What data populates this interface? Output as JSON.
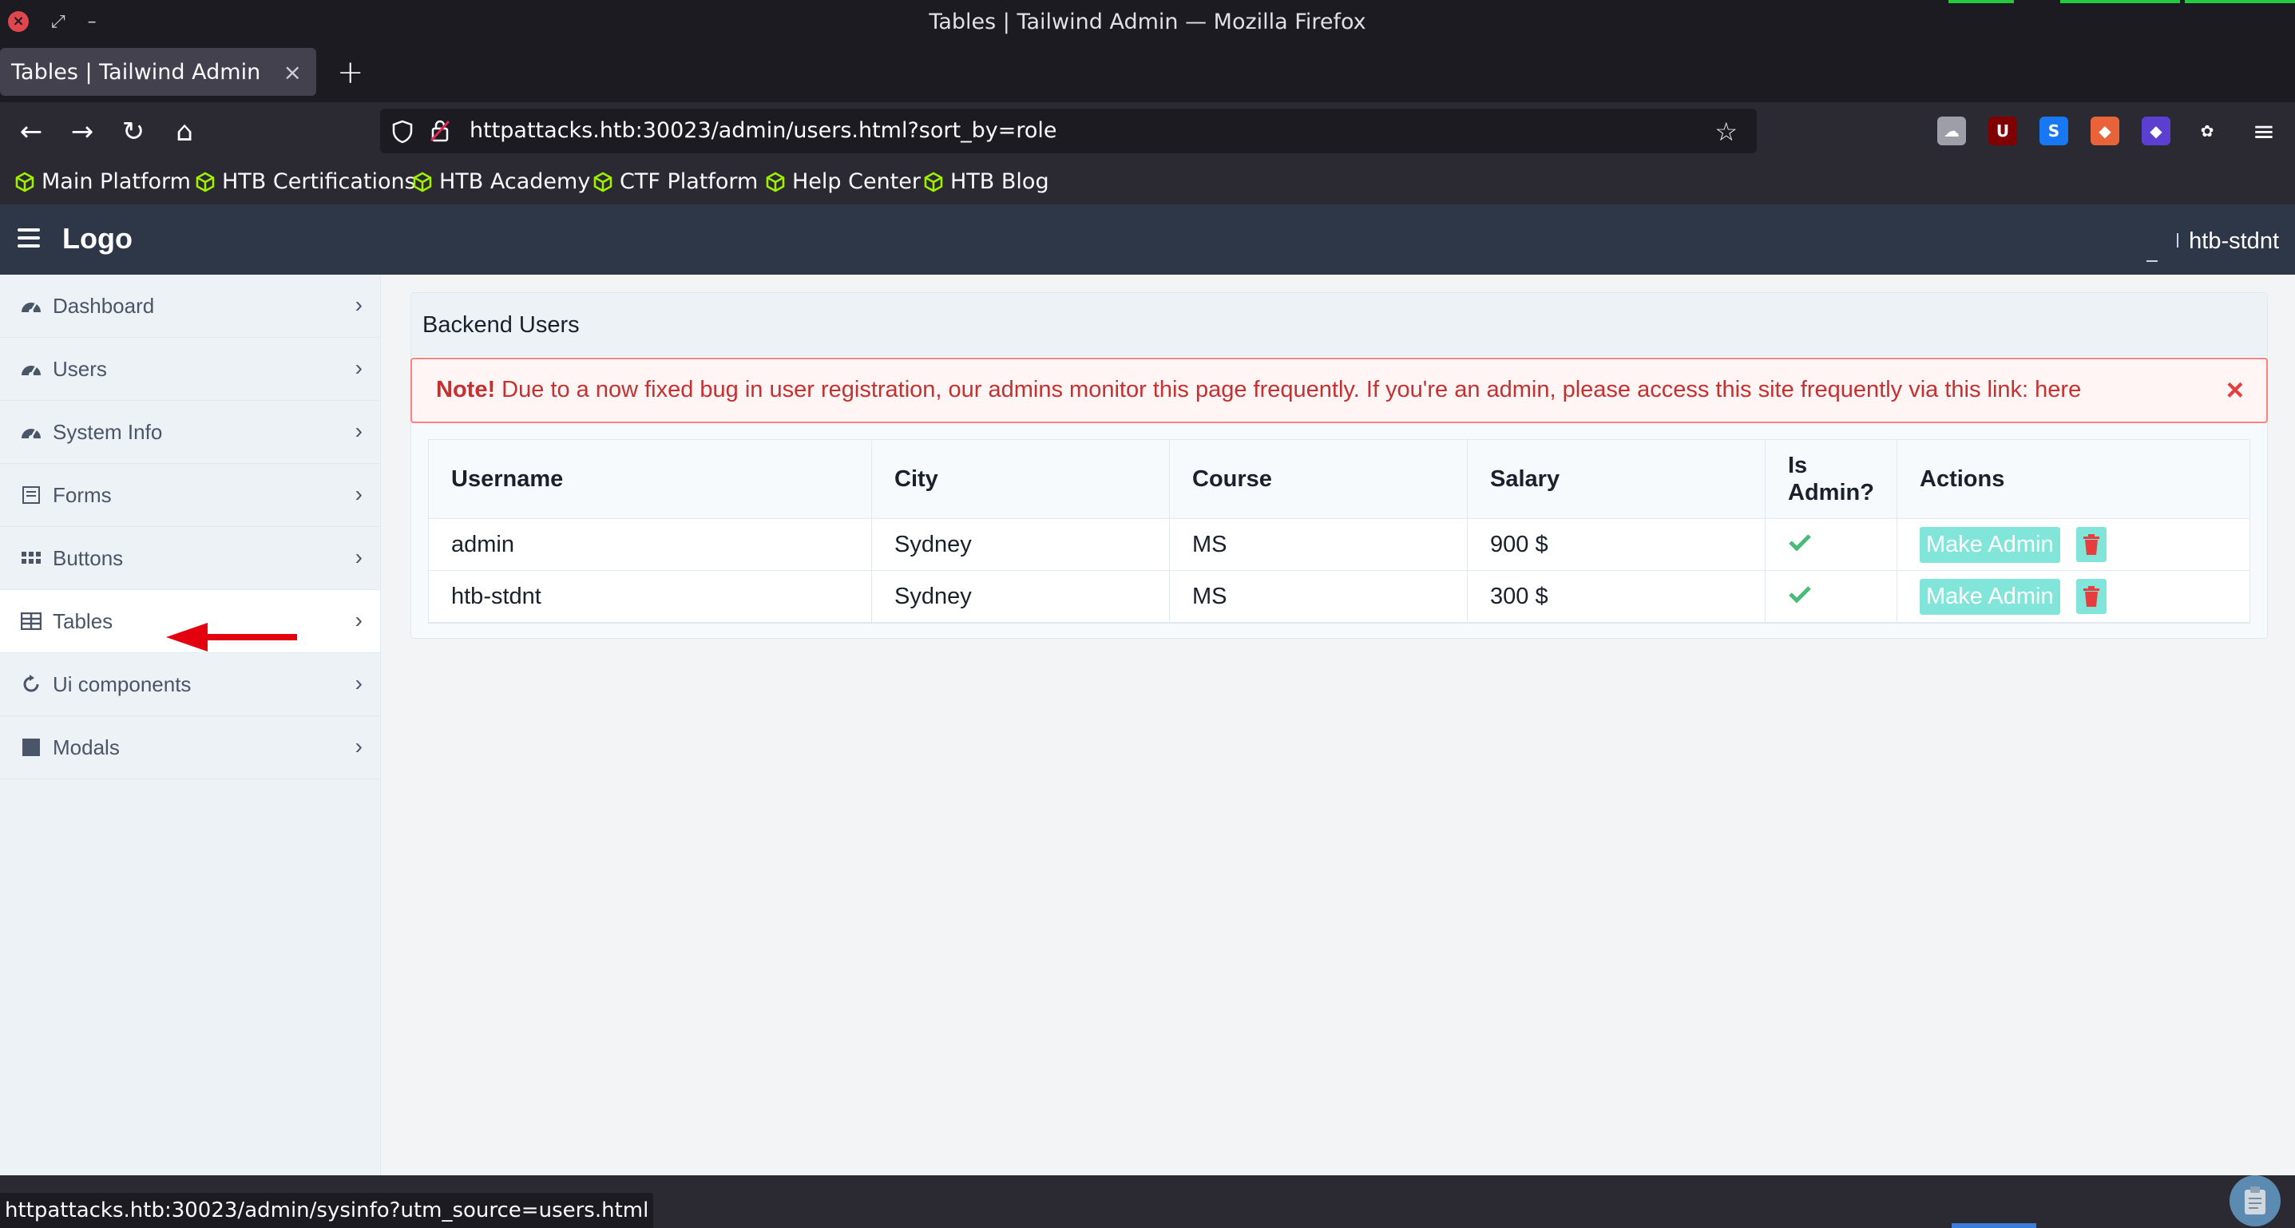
{
  "window": {
    "title": "Tables | Tailwind Admin — Mozilla Firefox"
  },
  "tab": {
    "title": "Tables | Tailwind Admin",
    "close": "×",
    "new_tab": "+"
  },
  "nav": {
    "back": "←",
    "forward": "→",
    "reload": "↻",
    "home": "⌂",
    "url": "httpattacks.htb:30023/admin/users.html?sort_by=role",
    "star": "☆",
    "menu": "≡",
    "extensions": [
      {
        "name": "ext-cloud-icon",
        "glyph": "☁",
        "color": "#9e9ea8"
      },
      {
        "name": "ublock-icon",
        "glyph": "U",
        "color": "#800000"
      },
      {
        "name": "s-extension-icon",
        "glyph": "S",
        "color": "#1877f2"
      },
      {
        "name": "fox-extension-icon",
        "glyph": "◆",
        "color": "#e8633a"
      },
      {
        "name": "cube-extension-icon",
        "glyph": "◆",
        "color": "#5b3fd1"
      },
      {
        "name": "cookie-extension-icon",
        "glyph": "✿",
        "color": "#2b2a33"
      }
    ]
  },
  "bookmarks": [
    "Main Platform",
    "HTB Certifications",
    "HTB Academy",
    "CTF Platform",
    "Help Center",
    "HTB Blog"
  ],
  "app": {
    "logo": "Logo",
    "user": "htb-stdnt"
  },
  "sidebar": {
    "items": [
      {
        "label": "Dashboard",
        "icon": "gauge-icon",
        "active": false
      },
      {
        "label": "Users",
        "icon": "gauge-icon",
        "active": false
      },
      {
        "label": "System Info",
        "icon": "gauge-icon",
        "active": false
      },
      {
        "label": "Forms",
        "icon": "form-icon",
        "active": false
      },
      {
        "label": "Buttons",
        "icon": "grid-icon",
        "active": false
      },
      {
        "label": "Tables",
        "icon": "table-icon",
        "active": true
      },
      {
        "label": "Ui components",
        "icon": "refresh-icon",
        "active": false
      },
      {
        "label": "Modals",
        "icon": "square-icon",
        "active": false
      }
    ],
    "chevron": "›"
  },
  "content": {
    "card_title": "Backend Users",
    "alert": {
      "strong": "Note!",
      "text": " Due to a now fixed bug in user registration, our admins monitor this page frequently. If you're an admin, please access this site frequently via this link: here",
      "close": "×"
    },
    "table": {
      "headers": [
        "Username",
        "City",
        "Course",
        "Salary",
        "Is\nAdmin?",
        "Actions"
      ],
      "rows": [
        {
          "username": "admin",
          "city": "Sydney",
          "course": "MS",
          "salary": "900 $",
          "is_admin": true,
          "action": "Make Admin"
        },
        {
          "username": "htb-stdnt",
          "city": "Sydney",
          "course": "MS",
          "salary": "300 $",
          "is_admin": true,
          "action": "Make Admin"
        }
      ]
    }
  },
  "status": {
    "link": "httpattacks.htb:30023/admin/sysinfo?utm_source=users.html"
  },
  "colors": {
    "accent_teal": "#81e6d9",
    "alert_red": "#c53030",
    "check_green": "#48bb78",
    "trash_red": "#e53e3e",
    "arrow_red": "#e3000f"
  }
}
